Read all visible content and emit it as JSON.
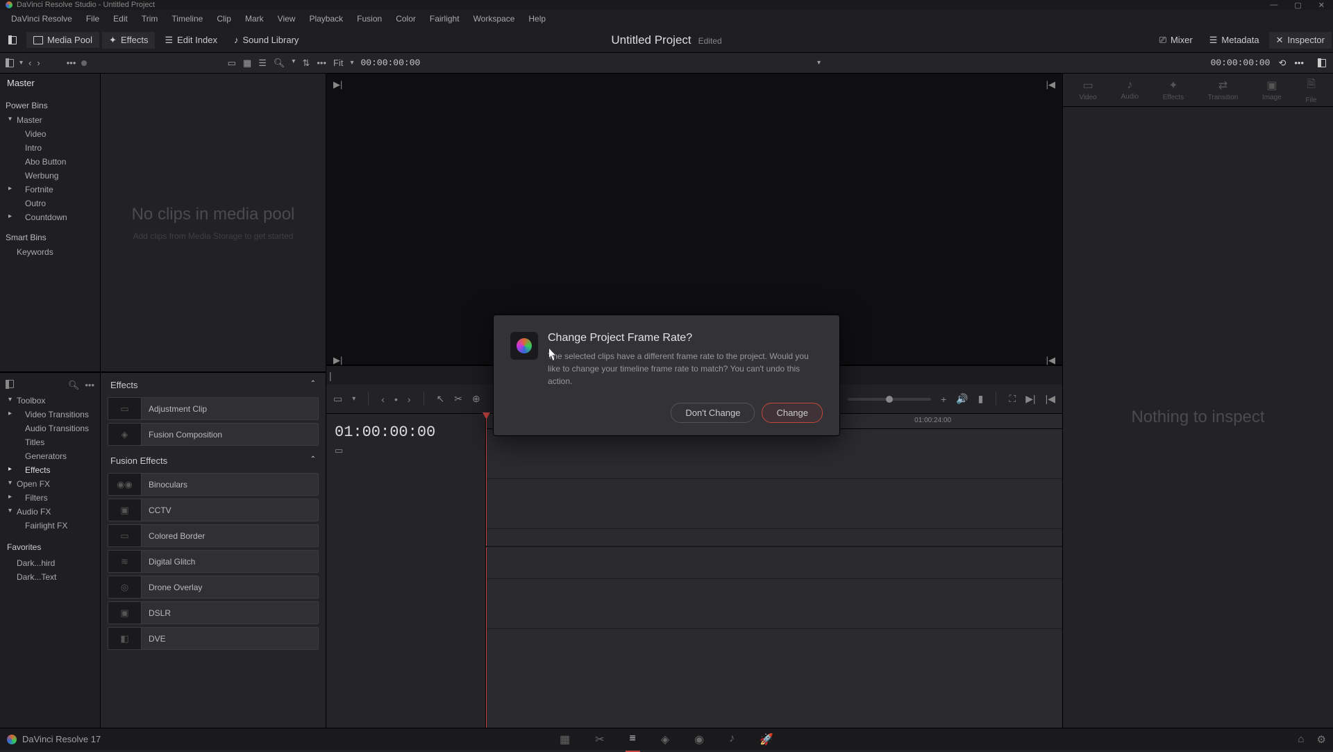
{
  "titlebar": {
    "text": "DaVinci Resolve Studio - Untitled Project"
  },
  "menu": [
    "DaVinci Resolve",
    "File",
    "Edit",
    "Trim",
    "Timeline",
    "Clip",
    "Mark",
    "View",
    "Playback",
    "Fusion",
    "Color",
    "Fairlight",
    "Workspace",
    "Help"
  ],
  "header": {
    "mediaPool": "Media Pool",
    "effects": "Effects",
    "editIndex": "Edit Index",
    "soundLibrary": "Sound Library",
    "projectTitle": "Untitled Project",
    "edited": "Edited",
    "mixer": "Mixer",
    "metadata": "Metadata",
    "inspector": "Inspector"
  },
  "minirow": {
    "fit": "Fit",
    "tc_left": "00:00:00:00",
    "tc_right": "00:00:00:00"
  },
  "bins": {
    "master": "Master",
    "powerBins": "Power Bins",
    "items": [
      "Master",
      "Video",
      "Intro",
      "Abo Button",
      "Werbung",
      "Fortnite",
      "Outro",
      "Countdown"
    ],
    "smartBins": "Smart Bins",
    "smartItems": [
      "Keywords"
    ]
  },
  "mediaPool": {
    "empty1": "No clips in media pool",
    "empty2": "Add clips from Media Storage to get started"
  },
  "fxTree": {
    "toolbox": "Toolbox",
    "items1": [
      "Video Transitions",
      "Audio Transitions",
      "Titles",
      "Generators",
      "Effects"
    ],
    "openfx": "Open FX",
    "items2": [
      "Filters"
    ],
    "audiofx": "Audio FX",
    "items3": [
      "Fairlight FX"
    ],
    "favorites": "Favorites",
    "favs": [
      "Dark...hird",
      "Dark...Text"
    ]
  },
  "fxList": {
    "group1": "Effects",
    "effects": [
      "Adjustment Clip",
      "Fusion Composition"
    ],
    "group2": "Fusion Effects",
    "fusionEffects": [
      "Binoculars",
      "CCTV",
      "Colored Border",
      "Digital Glitch",
      "Drone Overlay",
      "DSLR",
      "DVE"
    ]
  },
  "inspector": {
    "tabs": [
      "Video",
      "Audio",
      "Effects",
      "Transition",
      "Image",
      "File"
    ],
    "nothing": "Nothing to inspect"
  },
  "timeline": {
    "tc": "01:00:00:00",
    "ruler": [
      "01:00:24:00"
    ]
  },
  "dialog": {
    "title": "Change Project Frame Rate?",
    "body": "The selected clips have a different frame rate to the project. Would you like to change your timeline frame rate to match? You can't undo this action.",
    "dont": "Don't Change",
    "change": "Change"
  },
  "botbar": {
    "version": "DaVinci Resolve 17"
  }
}
